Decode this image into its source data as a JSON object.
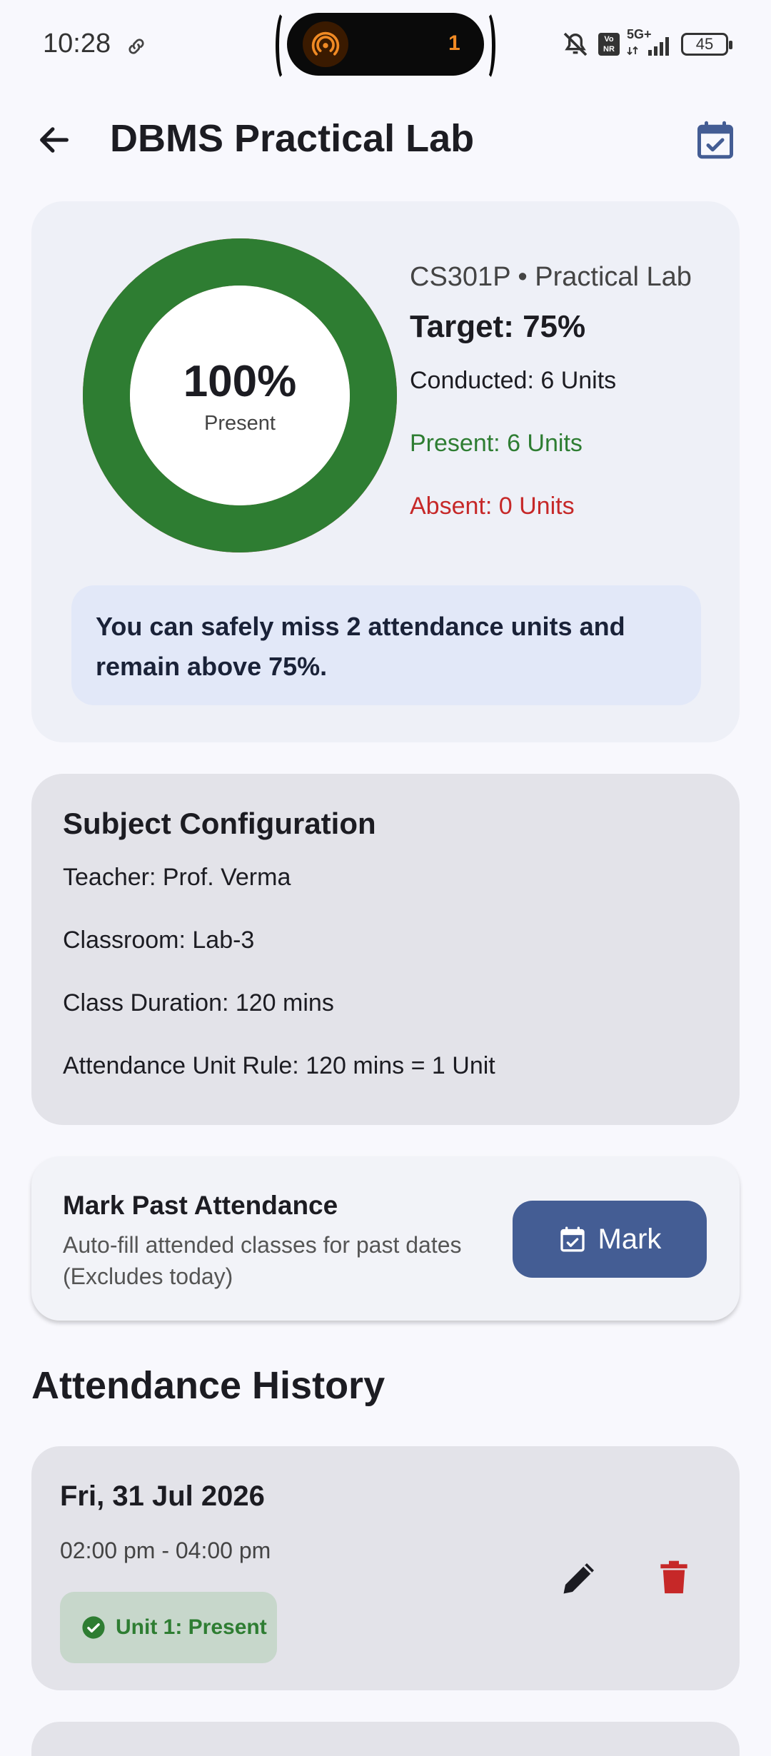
{
  "status_bar": {
    "time": "10:28",
    "island_count": "1",
    "network": "5G+",
    "volte": "Vo NR",
    "battery": "45",
    "icons": [
      "link-icon",
      "hotspot-icon",
      "mute-icon",
      "signal-icon",
      "battery-icon"
    ]
  },
  "app_bar": {
    "title": "DBMS Practical Lab",
    "back_icon": "arrow-left-icon",
    "action_icon": "calendar-check-icon"
  },
  "summary": {
    "percent": "100%",
    "percent_label": "Present",
    "attendance_fraction": 1.0,
    "subject_code": "CS301P • Practical Lab",
    "target": "Target: 75%",
    "conducted": "Conducted: 6 Units",
    "present": "Present: 6 Units",
    "absent": "Absent: 0 Units",
    "advice": "You can safely miss 2 attendance units and remain above 75%.",
    "colors": {
      "present": "#2e7d32",
      "absent": "#c62828"
    }
  },
  "config": {
    "title": "Subject Configuration",
    "teacher": "Teacher: Prof. Verma",
    "classroom": "Classroom: Lab-3",
    "duration": "Class Duration: 120 mins",
    "unit_rule": "Attendance Unit Rule: 120 mins = 1 Unit"
  },
  "mark_past": {
    "title": "Mark Past Attendance",
    "subtitle": "Auto-fill attended classes for past dates (Excludes today)",
    "button_label": "Mark",
    "button_color": "#445d94"
  },
  "history": {
    "title": "Attendance History",
    "entries": [
      {
        "date": "Fri, 31 Jul 2026",
        "time": "02:00 pm - 04:00 pm",
        "status": "Unit 1: Present"
      }
    ]
  }
}
